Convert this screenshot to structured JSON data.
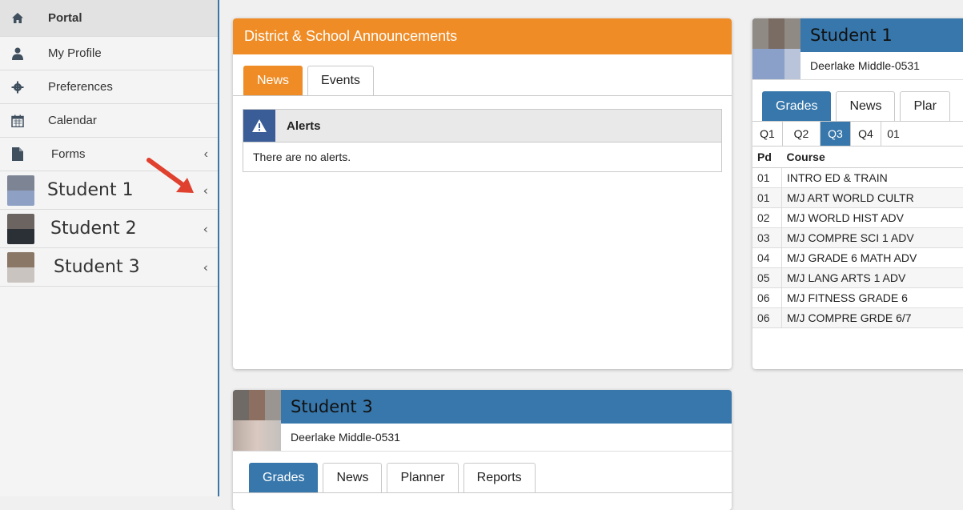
{
  "sidebar": {
    "items": [
      {
        "label": "Portal",
        "icon": "home-icon"
      },
      {
        "label": "My Profile",
        "icon": "user-icon"
      },
      {
        "label": "Preferences",
        "icon": "gear-icon"
      },
      {
        "label": "Calendar",
        "icon": "calendar-icon"
      },
      {
        "label": "Forms",
        "icon": "file-icon"
      }
    ],
    "students": [
      {
        "label": "Student 1"
      },
      {
        "label": "Student 2"
      },
      {
        "label": "Student 3"
      }
    ]
  },
  "announcements": {
    "title": "District & School Announcements",
    "tabs": [
      "News",
      "Events"
    ],
    "alerts_title": "Alerts",
    "alerts_message": "There are no alerts."
  },
  "student_card_1": {
    "name": "Student 1",
    "school": "Deerlake Middle-0531",
    "tabs": [
      "Grades",
      "News",
      "Plar"
    ],
    "quarters": [
      "Q1",
      "Q2",
      "Q3",
      "Q4",
      "01"
    ],
    "table_headers": [
      "Pd",
      "Course"
    ],
    "rows": [
      {
        "pd": "01",
        "course": "INTRO ED & TRAIN"
      },
      {
        "pd": "01",
        "course": "M/J ART WORLD CULTR"
      },
      {
        "pd": "02",
        "course": "M/J WORLD HIST ADV"
      },
      {
        "pd": "03",
        "course": "M/J COMPRE SCI 1 ADV"
      },
      {
        "pd": "04",
        "course": "M/J GRADE 6 MATH ADV"
      },
      {
        "pd": "05",
        "course": "M/J LANG ARTS 1 ADV"
      },
      {
        "pd": "06",
        "course": "M/J FITNESS GRADE 6"
      },
      {
        "pd": "06",
        "course": "M/J COMPRE GRDE 6/7"
      }
    ]
  },
  "student_card_3": {
    "name": "Student 3",
    "school": "Deerlake Middle-0531",
    "tabs": [
      "Grades",
      "News",
      "Planner",
      "Reports"
    ]
  },
  "colors": {
    "accent_blue": "#3777ab",
    "accent_orange": "#ef8c26",
    "alert_blue": "#3a5d97",
    "arrow_red": "#e0402e"
  },
  "chevron": "‹"
}
